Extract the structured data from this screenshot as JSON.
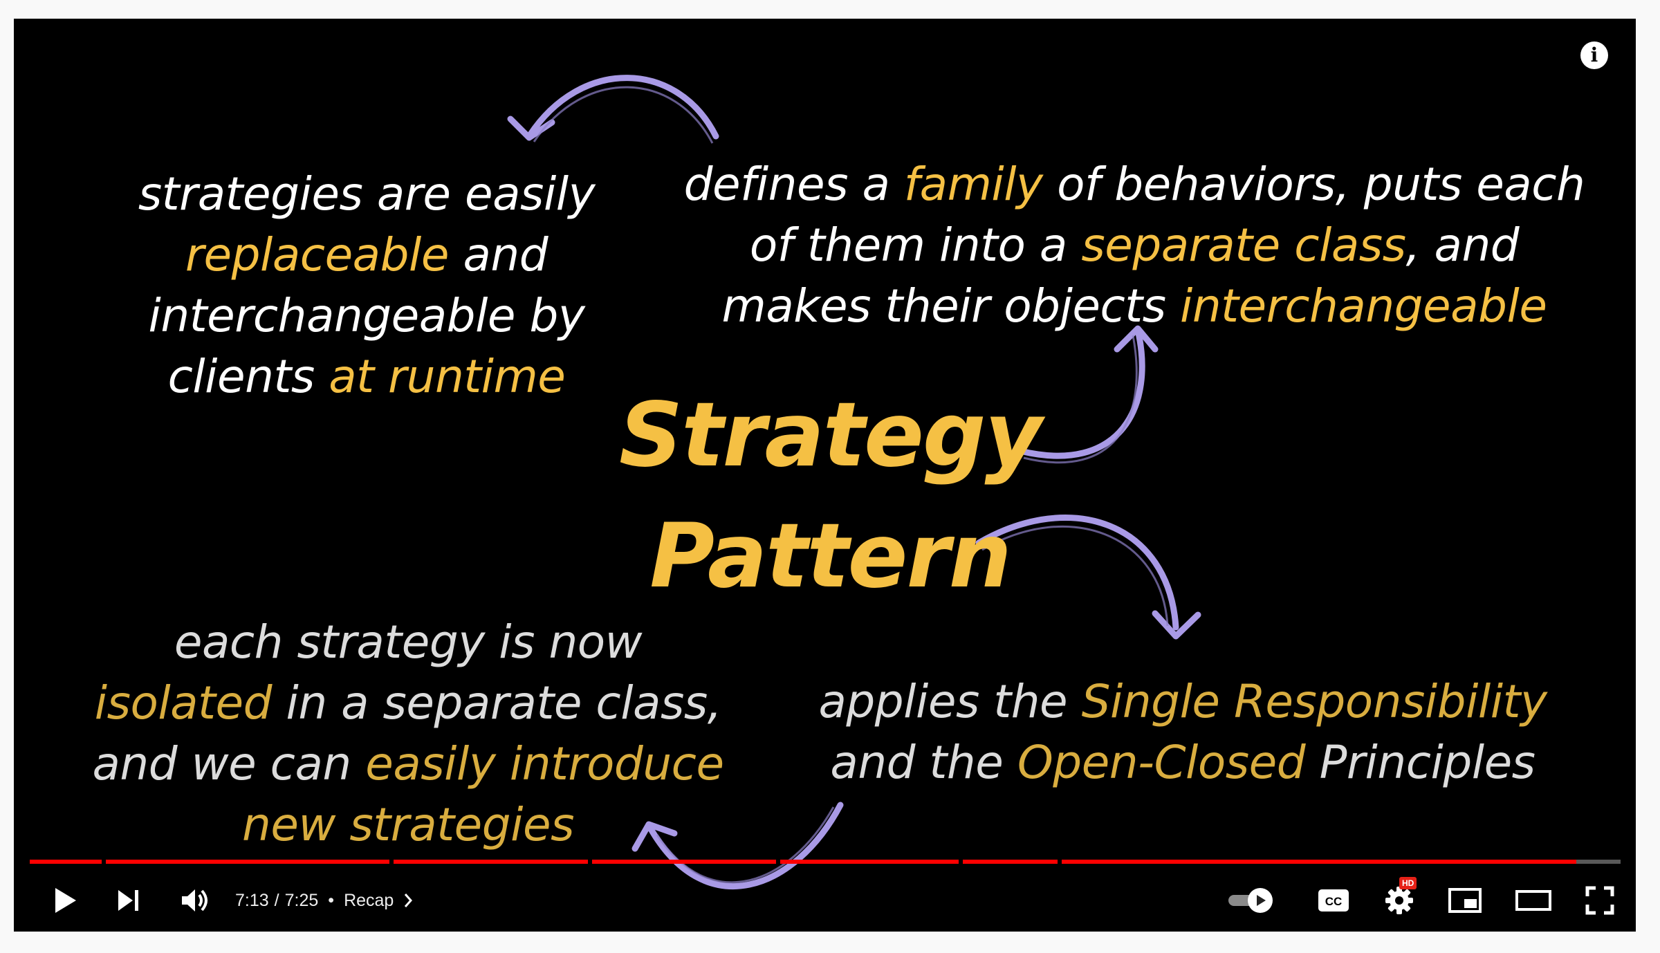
{
  "slide": {
    "title_line1": "Strategy",
    "title_line2": "Pattern",
    "top_left": [
      "strategies are easily",
      {
        "hl": "replaceable",
        "rest": " and"
      },
      "interchangeable by",
      {
        "pre": "clients ",
        "hl": "at runtime"
      }
    ],
    "top_right": {
      "l1_a": "defines a ",
      "l1_hl": "family",
      "l1_b": " of behaviors, puts each",
      "l2_a": "of them into a ",
      "l2_hl": "separate class",
      "l2_b": ", and",
      "l3_a": "makes their objects ",
      "l3_hl": "interchangeable"
    },
    "bottom_left": {
      "l1": "each strategy is now",
      "l2_hl": "isolated",
      "l2_b": " in a separate class,",
      "l3_a": "and we can ",
      "l3_hl": "easily introduce",
      "l4_hl": "new strategies"
    },
    "bottom_right": {
      "l1_a": "applies the ",
      "l1_hl": "Single Responsibility",
      "l2_a": "and the ",
      "l2_hl": "Open-Closed",
      "l2_b": " Principles"
    },
    "colors": {
      "highlight": "#f5c044",
      "arrow": "#a99ae6",
      "progress": "#ff0000"
    }
  },
  "info_icon": "i",
  "player": {
    "current_time": "7:13",
    "separator": "/",
    "duration": "7:25",
    "dot": "•",
    "chapter": "Recap",
    "progress_fraction": 0.972,
    "chapter_gaps": [
      0.045,
      0.226,
      0.351,
      0.469,
      0.584,
      0.646
    ],
    "hd_badge": "HD",
    "cc_label": "CC",
    "icons": [
      "play-icon",
      "next-icon",
      "volume-icon",
      "chevron-right-icon",
      "autoplay-toggle-icon",
      "captions-icon",
      "settings-icon",
      "miniplayer-icon",
      "theater-icon",
      "fullscreen-icon"
    ]
  }
}
